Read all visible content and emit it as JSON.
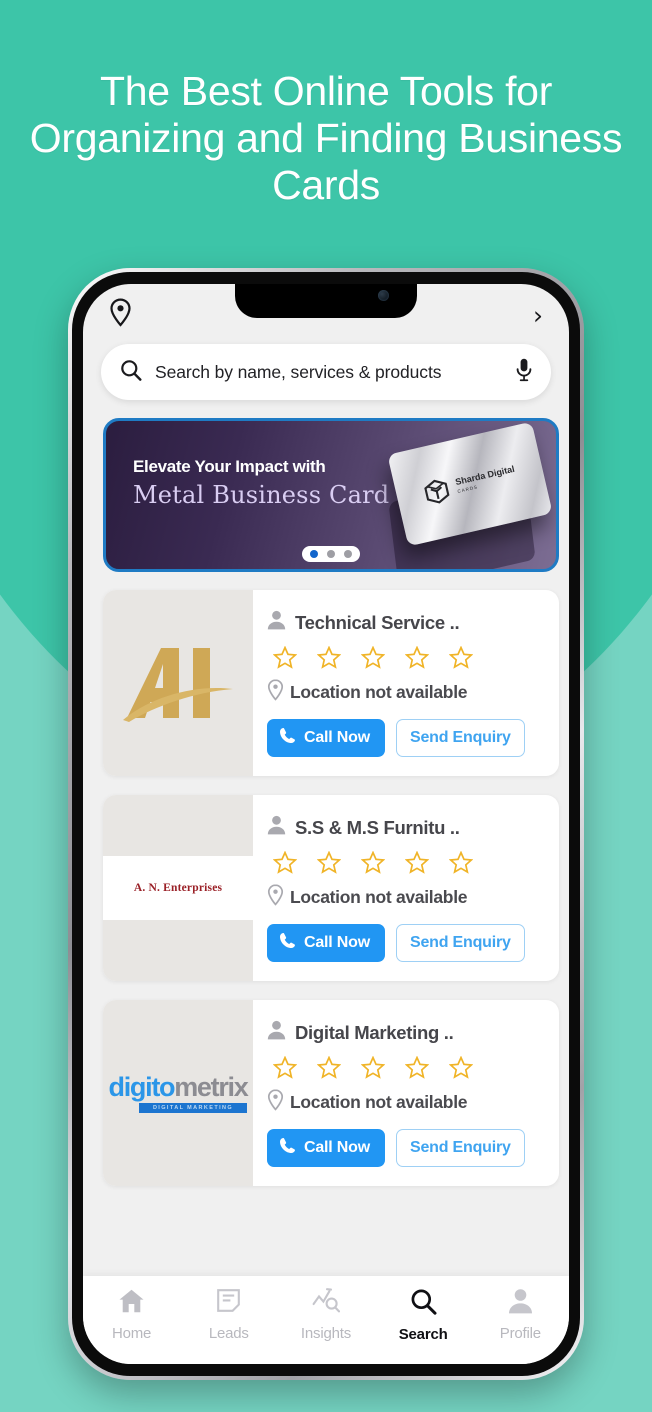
{
  "theme": {
    "bg_dark_teal": "#3DC5A8",
    "bg_light_teal": "#75D4C2",
    "accent_blue": "#2196F3",
    "banner_border": "#1F7BC4",
    "star_gold": "#F0B428",
    "app_bg": "#F0F0F0"
  },
  "headline": "The Best Online Tools for Organizing and Finding Business Cards",
  "app": {
    "status_bar": {
      "location_icon": "location-pin-icon",
      "forward_chevron": "›"
    },
    "search": {
      "icon": "search-icon",
      "placeholder": "Search by name, services & products",
      "value": "",
      "mic_icon": "microphone-icon"
    },
    "banner": {
      "line1": "Elevate Your Impact with",
      "line2": "Metal Business Card",
      "card_logo_icon": "cube-logo-icon",
      "card_brand": "Sharda Digital",
      "card_brand_sub": "CARDS",
      "dots_total": 3,
      "dots_active_index": 0
    },
    "listings": [
      {
        "logo_type": "ai-monogram-logo",
        "logo_text": "Ai",
        "person_icon": "person-icon",
        "name": "Technical Service ..",
        "rating_icon": "star-outline-icon",
        "rating_stars": 5,
        "rating_filled": 0,
        "location_icon": "location-pin-icon",
        "location": "Location not available",
        "call_icon": "phone-icon",
        "call_label": "Call Now",
        "enquiry_label": "Send Enquiry"
      },
      {
        "logo_type": "an-enterprises-logo",
        "logo_text": "A. N. Enterprises",
        "person_icon": "person-icon",
        "name": "S.S & M.S Furnitu ..",
        "rating_icon": "star-outline-icon",
        "rating_stars": 5,
        "rating_filled": 0,
        "location_icon": "location-pin-icon",
        "location": "Location not available",
        "call_icon": "phone-icon",
        "call_label": "Call Now",
        "enquiry_label": "Send Enquiry"
      },
      {
        "logo_type": "digitometrix-logo",
        "logo_text_blue": "digito",
        "logo_text_gray": "metrix",
        "logo_bar_text": "DIGITAL MARKETING",
        "person_icon": "person-icon",
        "name": "Digital Marketing ..",
        "rating_icon": "star-outline-icon",
        "rating_stars": 5,
        "rating_filled": 0,
        "location_icon": "location-pin-icon",
        "location": "Location not available",
        "call_icon": "phone-icon",
        "call_label": "Call Now",
        "enquiry_label": "Send Enquiry"
      }
    ],
    "bottom_nav": {
      "items": [
        {
          "label": "Home",
          "icon": "home-icon",
          "active": false
        },
        {
          "label": "Leads",
          "icon": "note-icon",
          "active": false
        },
        {
          "label": "Insights",
          "icon": "analytics-icon",
          "active": false
        },
        {
          "label": "Search",
          "icon": "search-icon",
          "active": true
        },
        {
          "label": "Profile",
          "icon": "person-icon",
          "active": false
        }
      ]
    }
  }
}
